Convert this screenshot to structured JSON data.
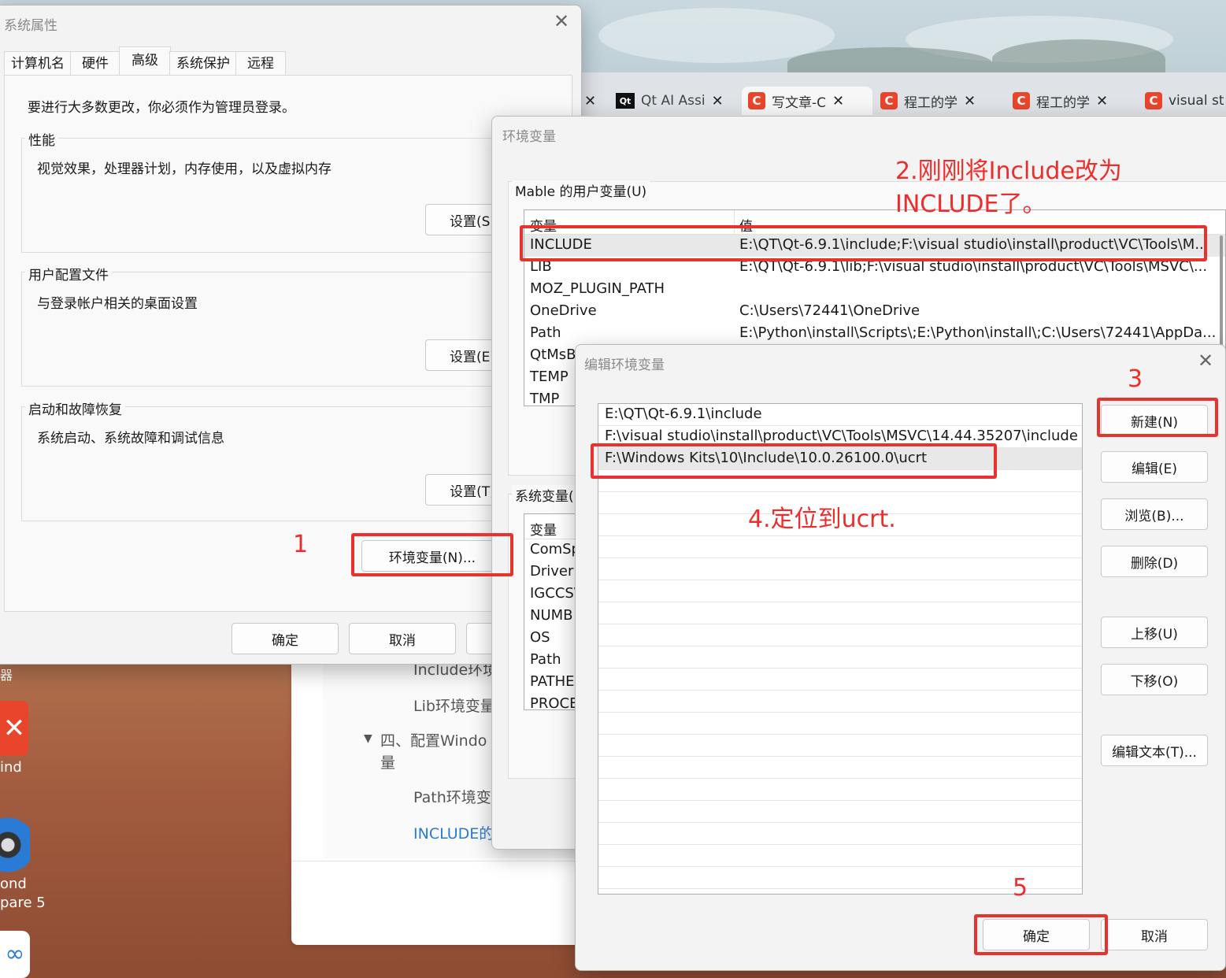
{
  "browser": {
    "tabs": [
      {
        "label": "Qt AI Assi",
        "icon": "qt"
      },
      {
        "label": "写文章-C",
        "icon": "csdn",
        "active": true
      },
      {
        "label": "程工的学",
        "icon": "csdn"
      },
      {
        "label": "程工的学",
        "icon": "csdn"
      },
      {
        "label": "visual st",
        "icon": "csdn"
      }
    ],
    "toc": {
      "item1": "Include环境",
      "item2": "Lib环境变量",
      "item3_line1": "四、配置Windo",
      "item3_line2": "量",
      "item4": "Path环境变",
      "item5": "INCLUDE的"
    }
  },
  "desktop": {
    "icon_labels": [
      "ind",
      "ond",
      "pare 5"
    ],
    "char": "器"
  },
  "sysprops": {
    "title": "系统属性",
    "tabs": [
      "计算机名",
      "硬件",
      "高级",
      "系统保护",
      "远程"
    ],
    "admin_note": "要进行大多数更改，你必须作为管理员登录。",
    "perf_label": "性能",
    "perf_desc": "视觉效果，处理器计划，内存使用，以及虚拟内存",
    "perf_btn": "设置(S)",
    "profile_label": "用户配置文件",
    "profile_desc": "与登录帐户相关的桌面设置",
    "profile_btn": "设置(E)",
    "startup_label": "启动和故障恢复",
    "startup_desc": "系统启动、系统故障和调试信息",
    "startup_btn": "设置(T)",
    "env_btn": "环境变量(N)...",
    "ok": "确定",
    "cancel": "取消"
  },
  "envvars": {
    "title": "环境变量",
    "user_label": "Mable 的用户变量(U)",
    "col_var": "变量",
    "col_val": "值",
    "user_rows": [
      {
        "name": "INCLUDE",
        "value": "E:\\QT\\Qt-6.9.1\\include;F:\\visual studio\\install\\product\\VC\\Tools\\M..."
      },
      {
        "name": "LIB",
        "value": "E:\\QT\\Qt-6.9.1\\lib;F:\\visual studio\\install\\product\\VC\\Tools\\MSVC\\..."
      },
      {
        "name": "MOZ_PLUGIN_PATH",
        "value": ""
      },
      {
        "name": "OneDrive",
        "value": "C:\\Users\\72441\\OneDrive"
      },
      {
        "name": "Path",
        "value": "E:\\Python\\install\\Scripts\\;E:\\Python\\install\\;C:\\Users\\72441\\AppDa..."
      },
      {
        "name": "QtMsB",
        "value": ""
      },
      {
        "name": "TEMP",
        "value": ""
      },
      {
        "name": "TMP",
        "value": ""
      }
    ],
    "sys_label": "系统变量(",
    "sys_rows": [
      "ComSp",
      "DriverD",
      "IGCCS\\",
      "NUMB",
      "OS",
      "Path",
      "PATHE",
      "PROCE"
    ]
  },
  "editenv": {
    "title": "编辑环境变量",
    "entries": [
      "E:\\QT\\Qt-6.9.1\\include",
      "F:\\visual studio\\install\\product\\VC\\Tools\\MSVC\\14.44.35207\\include",
      "F:\\Windows Kits\\10\\Include\\10.0.26100.0\\ucrt"
    ],
    "btn_new": "新建(N)",
    "btn_edit": "编辑(E)",
    "btn_browse": "浏览(B)...",
    "btn_delete": "删除(D)",
    "btn_up": "上移(U)",
    "btn_down": "下移(O)",
    "btn_edittext": "编辑文本(T)...",
    "ok": "确定",
    "cancel": "取消"
  },
  "annotations": {
    "n1": "1",
    "n2_line1": "2.刚刚将Include改为",
    "n2_line2": "INCLUDE了。",
    "n3": "3",
    "n4": "4.定位到ucrt.",
    "n5": "5",
    "color": "#e8322e"
  }
}
